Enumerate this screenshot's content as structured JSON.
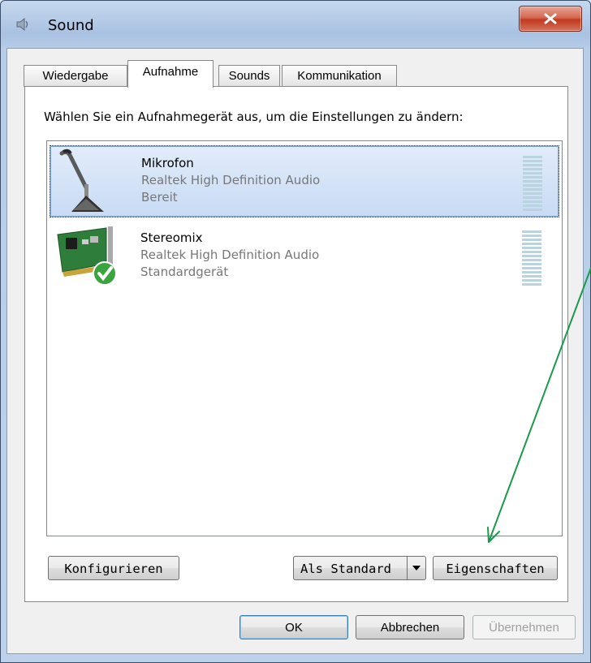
{
  "window": {
    "title": "Sound"
  },
  "tabs": [
    {
      "label": "Wiedergabe"
    },
    {
      "label": "Aufnahme"
    },
    {
      "label": "Sounds"
    },
    {
      "label": "Kommunikation"
    }
  ],
  "panel": {
    "instruction": "Wählen Sie ein Aufnahmegerät aus, um die Einstellungen zu ändern:"
  },
  "devices": [
    {
      "name": "Mikrofon",
      "description": "Realtek High Definition Audio",
      "status": "Bereit",
      "icon": "microphone-icon",
      "selected": true
    },
    {
      "name": "Stereomix",
      "description": "Realtek High Definition Audio",
      "status": "Standardgerät",
      "icon": "sound-card-icon",
      "selected": false
    }
  ],
  "buttons": {
    "configure": "Konfigurieren",
    "set_default": "Als Standard",
    "properties": "Eigenschaften",
    "ok": "OK",
    "cancel": "Abbrechen",
    "apply": "Übernehmen"
  },
  "colors": {
    "annotation_arrow": "#1a9a4a",
    "selection": "#c8dbf4",
    "close_button": "#c2391f"
  }
}
